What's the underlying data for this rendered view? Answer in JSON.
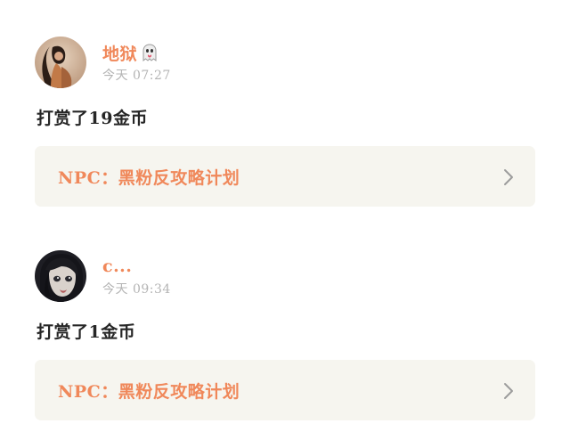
{
  "entries": [
    {
      "username": "地狱",
      "username_icon": "ghost-icon",
      "time": "今天 07:27",
      "message": "打赏了19金币",
      "card_title": "NPC：黑粉反攻略计划",
      "card_icon": "chevron-right-icon"
    },
    {
      "username": "c...",
      "time": "今天 09:34",
      "message": "打赏了1金币",
      "card_title": "NPC：黑粉反攻略计划",
      "card_icon": "chevron-right-icon"
    }
  ],
  "colors": {
    "accent": "#f0885a",
    "card_background": "#f6f5ef",
    "timestamp": "#b4b4b4",
    "message_text": "#262626"
  }
}
